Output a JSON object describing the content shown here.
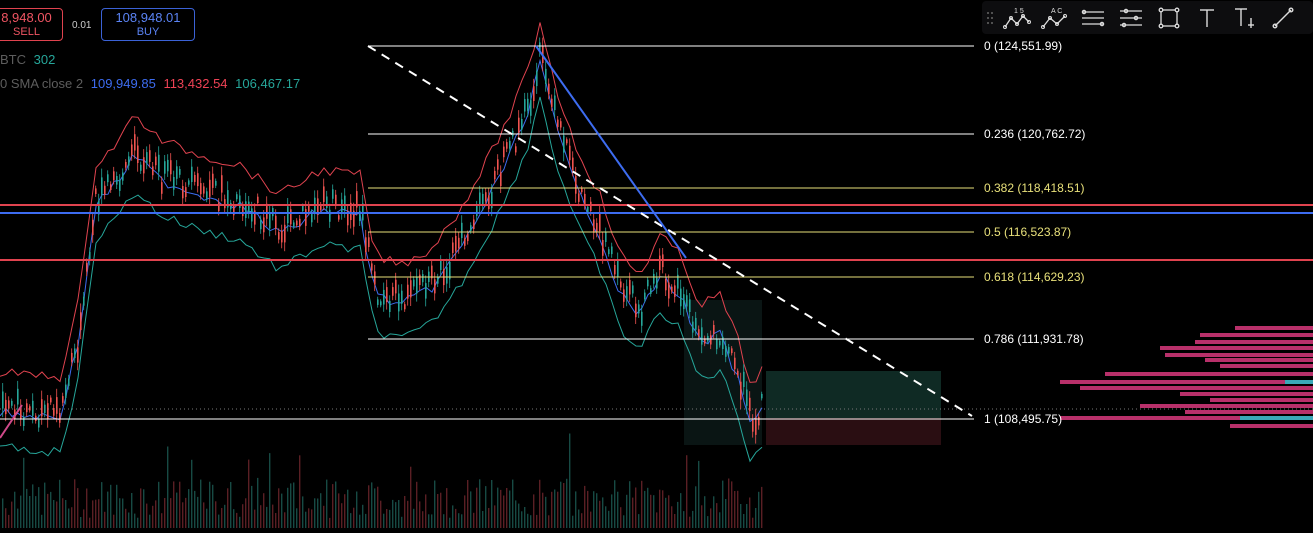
{
  "order_panel": {
    "sell_price": "8,948.00",
    "sell_label": "SELL",
    "spread": "0.01",
    "buy_price": "108,948.01",
    "buy_label": "BUY"
  },
  "indicators": {
    "volume": {
      "label": "BTC",
      "value": "302",
      "value_color": "#26a69a"
    },
    "bollinger": {
      "label": "0 SMA close 2",
      "basis": "109,949.85",
      "upper": "113,432.54",
      "lower": "106,467.17",
      "basis_color": "#3d6cf0",
      "upper_color": "#ef4255",
      "lower_color": "#26a69a"
    }
  },
  "fib_levels": [
    {
      "label": "0 (124,551.99)",
      "color": "#ffffff"
    },
    {
      "label": "0.236 (120,762.72)",
      "color": "#ffffff"
    },
    {
      "label": "0.382 (118,418.51)",
      "color": "#e8e07a"
    },
    {
      "label": "0.5 (116,523.87)",
      "color": "#e8e07a"
    },
    {
      "label": "0.618 (114,629.23)",
      "color": "#e8e07a"
    },
    {
      "label": "0.786 (111,931.78)",
      "color": "#ffffff"
    },
    {
      "label": "1 (108,495.75)",
      "color": "#ffffff"
    }
  ],
  "toolbar": {
    "tools": [
      {
        "name": "drag-handle-icon"
      },
      {
        "name": "xabcd-pattern-icon",
        "caption": "1 5"
      },
      {
        "name": "abcd-pattern-icon",
        "caption": "A C"
      },
      {
        "name": "parallel-channel-icon"
      },
      {
        "name": "pitchfork-icon"
      },
      {
        "name": "rectangle-icon"
      },
      {
        "name": "text-icon"
      },
      {
        "name": "anchored-text-icon"
      },
      {
        "name": "trend-line-icon"
      }
    ]
  },
  "colors": {
    "background": "#000000",
    "up_candle": "#26a69a",
    "down_candle": "#ef5350",
    "resistance_line": "#e0434f",
    "support_line": "#3d6cf0",
    "long_profit_zone": "#0f2a24",
    "long_loss_zone": "#2a0e12"
  }
}
